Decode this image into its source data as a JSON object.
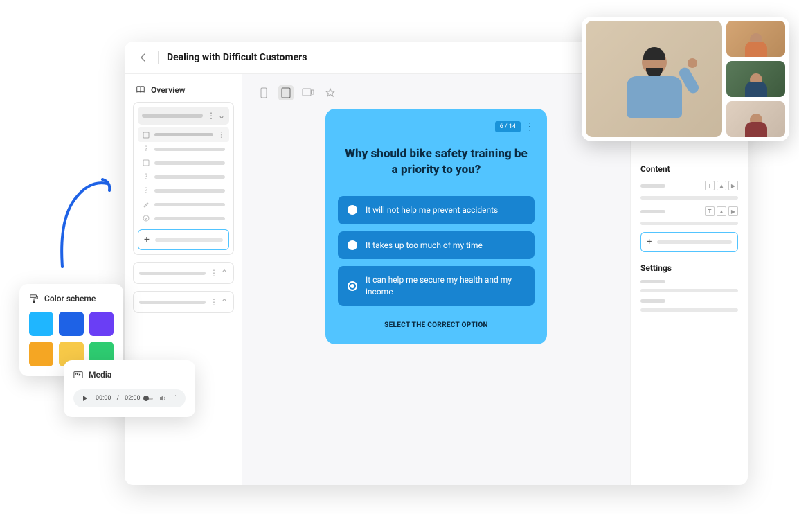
{
  "header": {
    "title": "Dealing with Difficult Customers"
  },
  "sidebar": {
    "overview_label": "Overview",
    "add_label": "+"
  },
  "quiz": {
    "page_indicator": "6 / 14",
    "title": "Why should bike safety training be a priority to you?",
    "options": [
      {
        "text": "It will not help me prevent accidents",
        "selected": false
      },
      {
        "text": "It takes up too much of my time",
        "selected": false
      },
      {
        "text": "It can help me secure my health and my income",
        "selected": true
      }
    ],
    "cta": "SELECT THE CORRECT OPTION"
  },
  "right_panel": {
    "content_title": "Content",
    "settings_title": "Settings",
    "add_label": "+"
  },
  "color_panel": {
    "title": "Color scheme",
    "swatches": [
      "#1FB6FF",
      "#1E62E6",
      "#6A3EF5",
      "#F5A623",
      "#F7C948",
      "#2ECC71"
    ]
  },
  "media_panel": {
    "title": "Media",
    "current_time": "00:00",
    "duration": "02:00"
  }
}
